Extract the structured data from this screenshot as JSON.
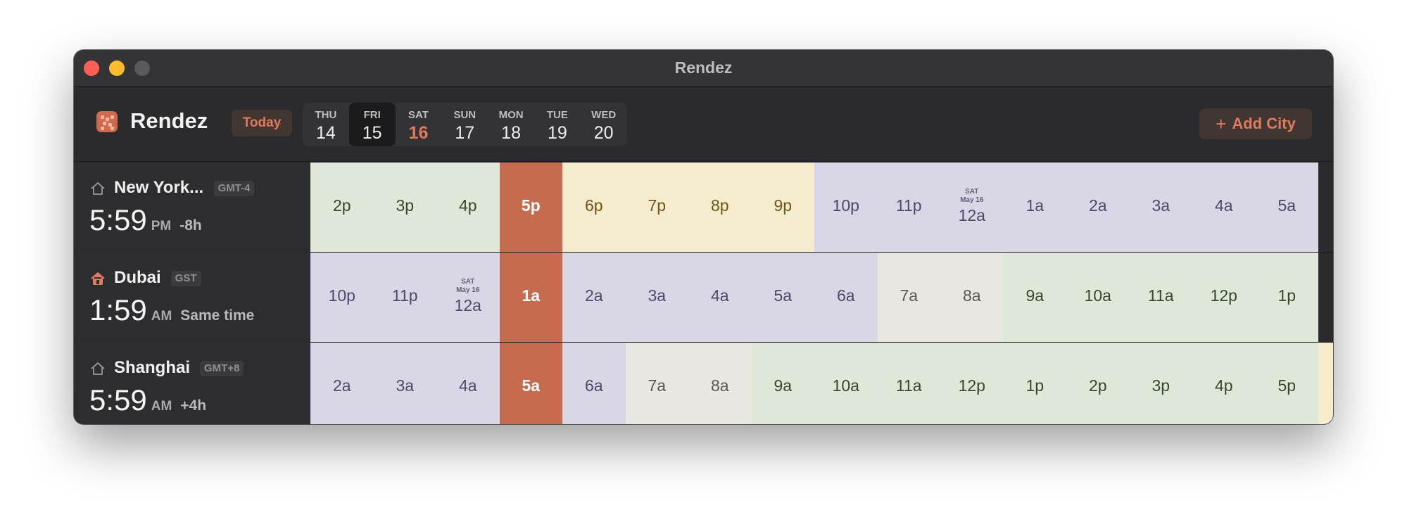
{
  "window": {
    "title": "Rendez"
  },
  "toolbar": {
    "app_name": "Rendez",
    "today_label": "Today",
    "add_city_label": "Add City",
    "days": [
      {
        "dow": "THU",
        "num": "14",
        "selected": false,
        "weekend": false
      },
      {
        "dow": "FRI",
        "num": "15",
        "selected": true,
        "weekend": false
      },
      {
        "dow": "SAT",
        "num": "16",
        "selected": false,
        "weekend": true
      },
      {
        "dow": "SUN",
        "num": "17",
        "selected": false,
        "weekend": false
      },
      {
        "dow": "MON",
        "num": "18",
        "selected": false,
        "weekend": false
      },
      {
        "dow": "TUE",
        "num": "19",
        "selected": false,
        "weekend": false
      },
      {
        "dow": "WED",
        "num": "20",
        "selected": false,
        "weekend": false
      }
    ]
  },
  "colors": {
    "accent": "#e07a5c",
    "now_column": "#c76b4e",
    "working": "#dfe8d8",
    "evening": "#f5ebcd",
    "night": "#d9d7e5",
    "early": "#e9e7e2"
  },
  "cities": [
    {
      "name": "New York...",
      "tz": "GMT-4",
      "home": false,
      "time": "5:59",
      "ampm": "PM",
      "offset": "-8h",
      "icon": "house-outline-icon",
      "hours": [
        {
          "label": "2p",
          "c": "green"
        },
        {
          "label": "3p",
          "c": "green"
        },
        {
          "label": "4p",
          "c": "green"
        },
        {
          "label": "5p",
          "c": "now"
        },
        {
          "label": "6p",
          "c": "yellow"
        },
        {
          "label": "7p",
          "c": "yellow"
        },
        {
          "label": "8p",
          "c": "yellow"
        },
        {
          "label": "9p",
          "c": "yellow"
        },
        {
          "label": "10p",
          "c": "lav"
        },
        {
          "label": "11p",
          "c": "lav"
        },
        {
          "label": "12a",
          "c": "lav",
          "tag1": "SAT",
          "tag2": "May 16"
        },
        {
          "label": "1a",
          "c": "lav"
        },
        {
          "label": "2a",
          "c": "lav"
        },
        {
          "label": "3a",
          "c": "lav"
        },
        {
          "label": "4a",
          "c": "lav"
        },
        {
          "label": "5a",
          "c": "lav"
        }
      ]
    },
    {
      "name": "Dubai",
      "tz": "GST",
      "home": true,
      "time": "1:59",
      "ampm": "AM",
      "offset": "Same time",
      "icon": "house-filled-icon",
      "hours": [
        {
          "label": "10p",
          "c": "lav"
        },
        {
          "label": "11p",
          "c": "lav"
        },
        {
          "label": "12a",
          "c": "lav",
          "tag1": "SAT",
          "tag2": "May 16"
        },
        {
          "label": "1a",
          "c": "now"
        },
        {
          "label": "2a",
          "c": "lav"
        },
        {
          "label": "3a",
          "c": "lav"
        },
        {
          "label": "4a",
          "c": "lav"
        },
        {
          "label": "5a",
          "c": "lav"
        },
        {
          "label": "6a",
          "c": "lav"
        },
        {
          "label": "7a",
          "c": "gray"
        },
        {
          "label": "8a",
          "c": "gray"
        },
        {
          "label": "9a",
          "c": "green"
        },
        {
          "label": "10a",
          "c": "green"
        },
        {
          "label": "11a",
          "c": "green"
        },
        {
          "label": "12p",
          "c": "green"
        },
        {
          "label": "1p",
          "c": "green"
        }
      ]
    },
    {
      "name": "Shanghai",
      "tz": "GMT+8",
      "home": false,
      "time": "5:59",
      "ampm": "AM",
      "offset": "+4h",
      "icon": "house-outline-icon",
      "hours": [
        {
          "label": "2a",
          "c": "lav"
        },
        {
          "label": "3a",
          "c": "lav"
        },
        {
          "label": "4a",
          "c": "lav"
        },
        {
          "label": "5a",
          "c": "now"
        },
        {
          "label": "6a",
          "c": "lav"
        },
        {
          "label": "7a",
          "c": "gray"
        },
        {
          "label": "8a",
          "c": "gray"
        },
        {
          "label": "9a",
          "c": "green"
        },
        {
          "label": "10a",
          "c": "green"
        },
        {
          "label": "11a",
          "c": "green"
        },
        {
          "label": "12p",
          "c": "green"
        },
        {
          "label": "1p",
          "c": "green"
        },
        {
          "label": "2p",
          "c": "green"
        },
        {
          "label": "3p",
          "c": "green"
        },
        {
          "label": "4p",
          "c": "green"
        },
        {
          "label": "5p",
          "c": "green"
        }
      ]
    }
  ]
}
